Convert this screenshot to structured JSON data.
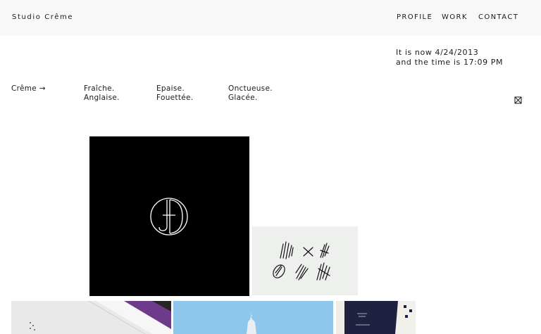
{
  "header": {
    "brand": "Studio Crême",
    "nav": [
      "PROFILE",
      "WORK",
      "CONTACT"
    ]
  },
  "clock": {
    "line1": "It is now 4/24/2013",
    "line2": "and the time is 17:09 PM"
  },
  "categories": {
    "lead": "Crême →",
    "col1": [
      "Fraîche.",
      "Anglaise."
    ],
    "col2": [
      "Epaise.",
      "Fouettée."
    ],
    "col3": [
      "Onctueuse.",
      "Glacée."
    ]
  },
  "colors": {
    "topbar_bg": "#f8f8f8",
    "text": "#1a1a1a",
    "tile_black": "#000000",
    "tile_sketch_bg": "#eef0ee"
  },
  "icons": {
    "close": "close-icon",
    "monogram": "jd-monogram-logo",
    "sketch": "brush-sketch-art"
  }
}
